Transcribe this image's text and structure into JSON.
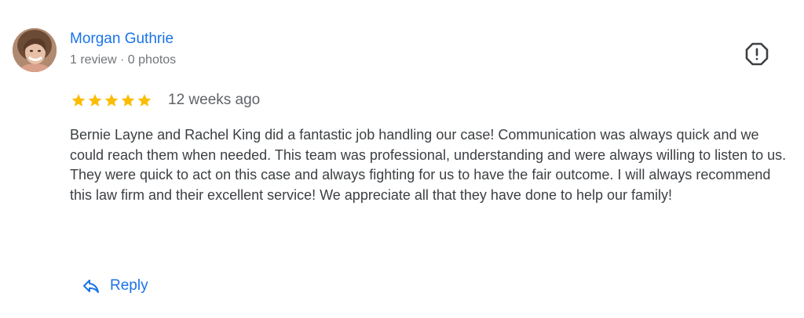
{
  "review": {
    "reviewer": {
      "name": "Morgan Guthrie",
      "meta": "1 review · 0 photos"
    },
    "rating": 5,
    "rating_max": 5,
    "date": "12 weeks ago",
    "text": "Bernie Layne and Rachel King did a fantastic job handling our case! Communication was always quick and we could reach them when needed. This team was professional, understanding and were always willing to listen to us. They were quick to act on this case and always fighting for us to have the fair outcome. I will always recommend this law firm and their excellent service! We appreciate all that they have done to help our family!",
    "reply_label": "Reply"
  },
  "icons": {
    "report": "report-flag-icon",
    "reply": "reply-arrow-icon",
    "star": "star-icon"
  },
  "colors": {
    "accent": "#1a73e8",
    "star": "#fbbc04",
    "text": "#3c4043",
    "muted": "#70757a"
  }
}
